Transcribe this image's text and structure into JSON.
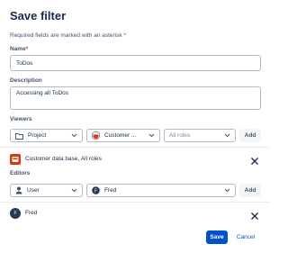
{
  "dialog": {
    "title": "Save filter",
    "required_note": "Required fields are marked with an asterisk",
    "required_marker": "*"
  },
  "name_field": {
    "label": "Name",
    "value": "ToDos"
  },
  "description_field": {
    "label": "Description",
    "value": "Accessing all ToDos"
  },
  "viewers": {
    "label": "Viewers",
    "type_select": "Project",
    "target_select": "Customer ...",
    "role_select_placeholder": "All roles",
    "add_label": "Add",
    "entries": [
      {
        "text": "Customer data base, All roles",
        "icon": "project-avatar-icon"
      }
    ]
  },
  "editors": {
    "label": "Editors",
    "type_select": "User",
    "user_select": "Fred",
    "add_label": "Add",
    "entries": [
      {
        "text": "Fred",
        "avatar_initial": "F"
      }
    ]
  },
  "footer": {
    "save_label": "Save",
    "cancel_label": "Cancel"
  },
  "colors": {
    "primary": "#0052cc",
    "text": "#172b4d",
    "border": "#b3bac5",
    "required": "#de350b"
  }
}
